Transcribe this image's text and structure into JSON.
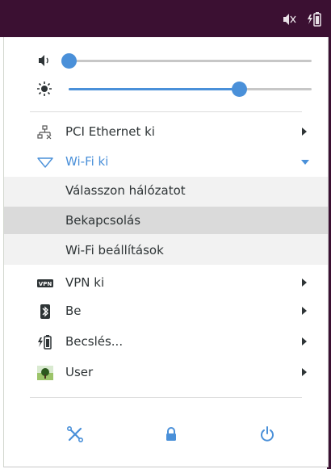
{
  "topbar": {
    "icons": [
      "speaker-muted-icon",
      "battery-icon"
    ],
    "colors": {
      "background": "#3b1032"
    }
  },
  "sliders": {
    "volume": {
      "icon": "speaker-icon",
      "level": 0.0
    },
    "brightness": {
      "icon": "brightness-icon",
      "level": 0.7
    }
  },
  "network": {
    "ethernet": {
      "label": "PCI Ethernet ki",
      "icon": "wired-network-icon"
    },
    "wifi": {
      "label": "Wi-Fi ki",
      "icon": "wifi-icon",
      "submenu": [
        "Válasszon hálózatot",
        "Bekapcsolás",
        "Wi-Fi beállítások"
      ]
    }
  },
  "vpn": {
    "label": "VPN ki",
    "icon": "vpn-icon"
  },
  "bluetooth": {
    "label": "Be",
    "icon": "bluetooth-icon"
  },
  "power": {
    "label": "Becslés...",
    "icon": "battery-icon"
  },
  "user": {
    "label": "User",
    "icon": "user-avatar-icon"
  },
  "actions": {
    "icons": [
      "settings-icon",
      "lock-icon",
      "power-off-icon"
    ]
  },
  "colors": {
    "accent": "#4a90d9",
    "submenu_bg": "#f2f2f2",
    "hover_bg": "#dadada"
  }
}
